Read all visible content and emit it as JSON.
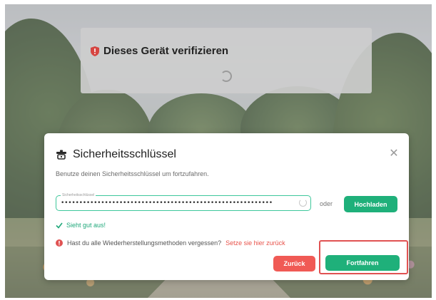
{
  "verify_card": {
    "title": "Dieses Gerät verifizieren"
  },
  "modal": {
    "title": "Sicherheitsschlüssel",
    "description": "Benutze deinen Sicherheitsschlüssel um fortzufahren.",
    "field": {
      "label": "Sicherheitsschlüssel",
      "value": "••••••••••••••••••••••••••••••••••••••••••••••••••••••••••"
    },
    "or_text": "oder",
    "upload_label": "Hochladen",
    "valid_text": "Sieht gut aus!",
    "forgot_text": "Hast du alle Wiederherstellungsmethoden vergessen?",
    "reset_link": "Setze sie hier zurück",
    "back_label": "Zurück",
    "continue_label": "Fortfahren"
  },
  "colors": {
    "accent_green": "#1fb07a",
    "danger_red": "#f05a55",
    "highlight_red": "#e05252",
    "link_red": "#e8524a"
  },
  "icons": {
    "verify": "shield-icon",
    "modal": "key-icon",
    "close": "close-icon",
    "valid": "check-icon",
    "warning": "alert-icon"
  }
}
